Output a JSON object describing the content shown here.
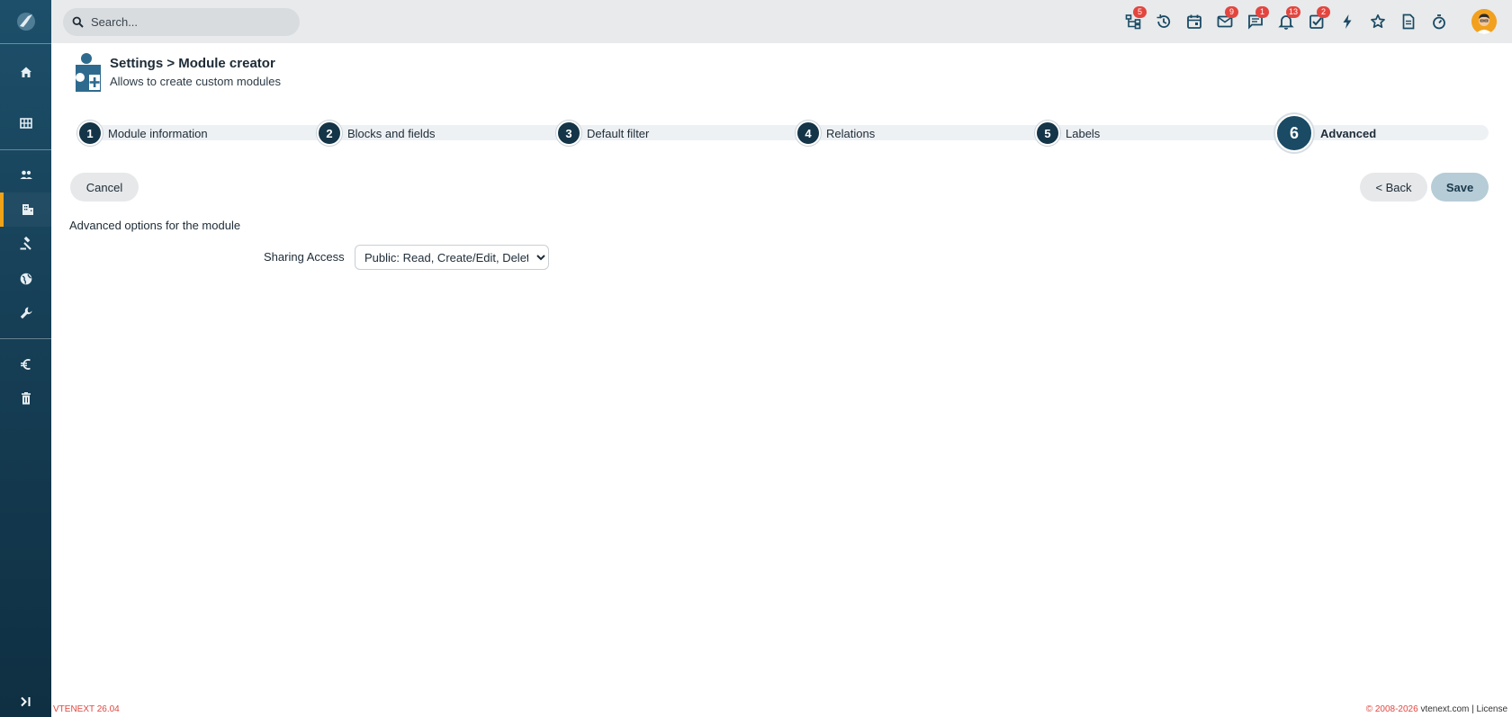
{
  "topbar": {
    "search_placeholder": "Search...",
    "icons": [
      {
        "name": "processes-icon",
        "badge": "5"
      },
      {
        "name": "history-icon",
        "badge": ""
      },
      {
        "name": "calendar-icon",
        "badge": ""
      },
      {
        "name": "mail-icon",
        "badge": "9"
      },
      {
        "name": "messages-icon",
        "badge": "1"
      },
      {
        "name": "notifications-icon",
        "badge": "13"
      },
      {
        "name": "tasks-icon",
        "badge": "2"
      },
      {
        "name": "quick-create-icon",
        "badge": ""
      },
      {
        "name": "favorites-icon",
        "badge": ""
      },
      {
        "name": "documents-icon",
        "badge": ""
      },
      {
        "name": "timer-icon",
        "badge": ""
      }
    ]
  },
  "sidebar": {
    "items": [
      "home-icon",
      "grid-icon",
      "users-icon",
      "company-icon",
      "auction-icon",
      "globe-icon",
      "wrench-icon",
      "euro-icon",
      "trash-icon"
    ],
    "active_index": 3
  },
  "header": {
    "title": "Settings > Module creator",
    "subtitle": "Allows to create custom modules"
  },
  "steps": [
    {
      "num": "1",
      "label": "Module information"
    },
    {
      "num": "2",
      "label": "Blocks and fields"
    },
    {
      "num": "3",
      "label": "Default filter"
    },
    {
      "num": "4",
      "label": "Relations"
    },
    {
      "num": "5",
      "label": "Labels"
    },
    {
      "num": "6",
      "label": "Advanced"
    }
  ],
  "current_step": "6",
  "buttons": {
    "cancel": "Cancel",
    "back": "< Back",
    "save": "Save"
  },
  "content": {
    "description": "Advanced options for the module",
    "sharing_label": "Sharing Access",
    "sharing_value": "Public: Read, Create/Edit, Delete"
  },
  "footer": {
    "version": "VTENEXT 26.04",
    "copyright": "© 2008-2026",
    "site": "vtenext.com",
    "separator": "|",
    "license": "License"
  },
  "colors": {
    "accent": "#f0a318",
    "badge": "#e2463f",
    "sidebar": "#163f56",
    "step": "#143448"
  }
}
